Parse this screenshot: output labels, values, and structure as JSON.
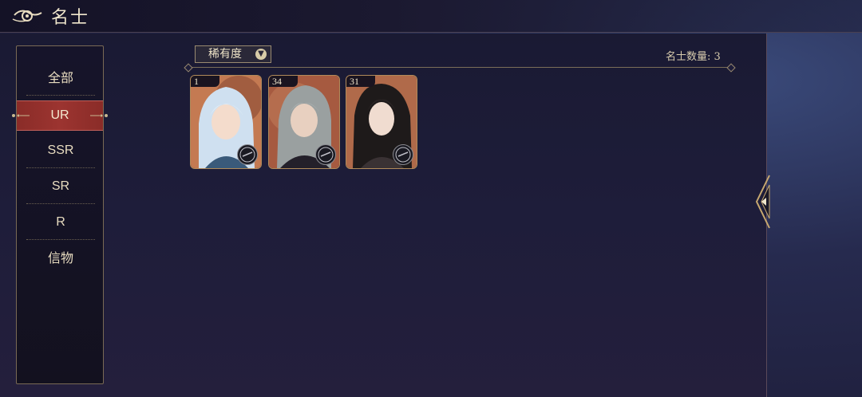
{
  "header": {
    "title": "名士",
    "back_icon": "swirl-back-icon"
  },
  "sidebar": {
    "items": [
      {
        "label": "全部"
      },
      {
        "label": "UR",
        "active": true
      },
      {
        "label": "SSR"
      },
      {
        "label": "SR"
      },
      {
        "label": "R"
      },
      {
        "label": "信物"
      }
    ]
  },
  "filter": {
    "label": "稀有度",
    "icon": "chevron-down-icon"
  },
  "count_text": "名士数量: 3",
  "cards": [
    {
      "level": "1",
      "hair": "#cfe0f0",
      "bg": "#c47a52"
    },
    {
      "level": "34",
      "hair": "#9aa0a0",
      "bg": "#a65a40"
    },
    {
      "level": "31",
      "hair": "#1e1a1a",
      "bg": "#b06a4a"
    }
  ],
  "colors": {
    "accent_active": "#9c3430",
    "gold_border": "#b08a5a"
  }
}
